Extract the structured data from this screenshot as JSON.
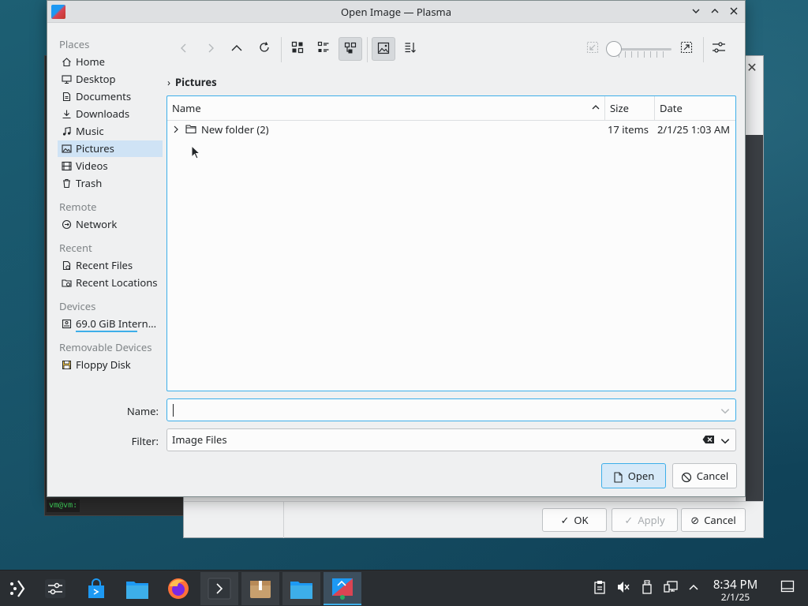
{
  "dialog": {
    "title": "Open Image — Plasma"
  },
  "sidebar": {
    "sections": [
      {
        "title": "Places",
        "items": [
          "Home",
          "Desktop",
          "Documents",
          "Downloads",
          "Music",
          "Pictures",
          "Videos",
          "Trash"
        ]
      },
      {
        "title": "Remote",
        "items": [
          "Network"
        ]
      },
      {
        "title": "Recent",
        "items": [
          "Recent Files",
          "Recent Locations"
        ]
      },
      {
        "title": "Devices",
        "items": [
          "69.0 GiB Intern..."
        ]
      },
      {
        "title": "Removable Devices",
        "items": [
          "Floppy Disk"
        ]
      }
    ],
    "active_item": "Pictures"
  },
  "breadcrumb": {
    "current": "Pictures"
  },
  "fileview": {
    "columns": [
      "Name",
      "Size",
      "Date"
    ],
    "rows": [
      {
        "name": "New folder (2)",
        "size": "17 items",
        "date": "2/1/25 1:03 AM"
      }
    ]
  },
  "form": {
    "name_label": "Name:",
    "name_value": "",
    "filter_label": "Filter:",
    "filter_value": "Image Files"
  },
  "buttons": {
    "open": "Open",
    "cancel": "Cancel"
  },
  "background_dialog": {
    "ok": "OK",
    "apply": "Apply",
    "cancel": "Cancel"
  },
  "terminal": {
    "prompt": "vm@vm:"
  },
  "taskbar": {
    "time": "8:34 PM",
    "date": "2/1/25"
  },
  "colors": {
    "accent": "#3daee9",
    "selection": "#cfe3f5",
    "taskbar": "#2a2e32"
  }
}
